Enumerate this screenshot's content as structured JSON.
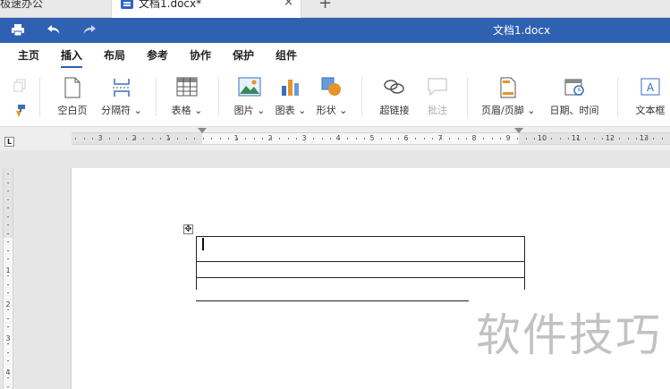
{
  "tabs": {
    "app_tab": "极速办公",
    "doc_tab": "文档1.docx*",
    "close_glyph": "×",
    "new_tab_glyph": "+"
  },
  "titlebar": {
    "doc_title": "文档1.docx"
  },
  "menu": {
    "items": [
      "主页",
      "插入",
      "布局",
      "参考",
      "协作",
      "保护",
      "组件"
    ],
    "active": "插入"
  },
  "ribbon": {
    "blank_page": "空白页",
    "page_break": "分隔符",
    "table": "表格",
    "picture": "图片",
    "chart": "图表",
    "shape": "形状",
    "hyperlink": "超链接",
    "comment": "批注",
    "header_footer": "页眉/页脚",
    "datetime": "日期、时间",
    "textbox": "文本框"
  },
  "ruler": {
    "corner_label": "L",
    "h_labels_left": [
      "3",
      "2",
      "1"
    ],
    "h_labels_right": [
      "1",
      "2",
      "3",
      "4",
      "5",
      "6",
      "7",
      "8",
      "9",
      "10",
      "11",
      "12",
      "13"
    ],
    "v_labels": [
      "1",
      "2",
      "3",
      "4"
    ]
  },
  "document": {
    "table_rows": 3,
    "table_handle_glyph": "✥"
  },
  "watermark": "软件技巧",
  "colors": {
    "titlebar": "#2f61b2",
    "accent": "#2f61b2"
  }
}
